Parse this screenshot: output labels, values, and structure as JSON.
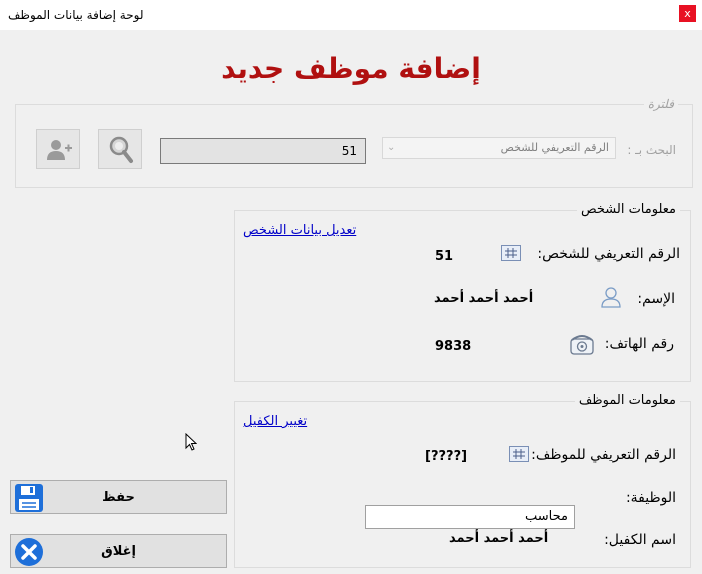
{
  "window": {
    "title": "لوحة إضافة بيانات الموظف",
    "close_glyph": "x"
  },
  "heading": "إضافة موظف جديد",
  "filter": {
    "legend": "فلترة",
    "search_by_label": "البحث بـ :",
    "search_by_value": "الرقم التعريفي للشخص",
    "search_value": "51",
    "search_icon": "magnifier-icon",
    "add_person_icon": "add-person-icon"
  },
  "person_info": {
    "legend": "معلومات الشخص",
    "edit_link": "تعديل بيانات الشخص",
    "id_label": "الرقم التعريفي للشخص:",
    "id_value": "51",
    "name_label": "الإسم:",
    "name_value": "أحمد أحمد  أحمد",
    "phone_label": "رقم الهاتف:",
    "phone_value": "9838"
  },
  "employee_info": {
    "legend": "معلومات الموظف",
    "change_sponsor_link": "تغيير الكفيل",
    "id_label": "الرقم التعريفي للموظف:",
    "id_value": "[????]",
    "job_label": "الوظيفة:",
    "job_value": "محاسب",
    "sponsor_label": "اسم الكفيل:",
    "sponsor_value": "أحمد أحمد  أحمد"
  },
  "buttons": {
    "save_label": "حفظ",
    "close_label": "إغلاق"
  },
  "colors": {
    "heading": "#b01010",
    "link": "#0000c8",
    "close_titlebar": "#e81123",
    "close_button_icon": "#1e6fd9"
  }
}
